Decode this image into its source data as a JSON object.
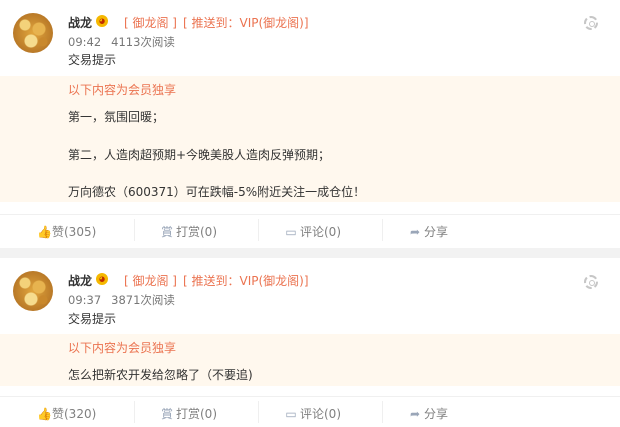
{
  "posts": [
    {
      "author": "战龙",
      "emoji": "😍",
      "tag1": "[ 御龙阁 ]",
      "tag2": "[ 推送到：VIP(御龙阁)]",
      "time": "09:42",
      "views": "4113次阅读",
      "title": "交易提示",
      "member_notice": "以下内容为会员独享",
      "lines": [
        "第一，氛围回暖；",
        "第二，人造肉超预期+今晚美股人造肉反弹预期；",
        "万向德农（600371）可在跌幅-5%附近关注一成仓位！"
      ],
      "actions": {
        "like": "赞(305)",
        "tip": "打赏(0)",
        "comment": "评论(0)",
        "share": "分享"
      }
    },
    {
      "author": "战龙",
      "emoji": "😍",
      "tag1": "[ 御龙阁 ]",
      "tag2": "[ 推送到：VIP(御龙阁)]",
      "time": "09:37",
      "views": "3871次阅读",
      "title": "交易提示",
      "member_notice": "以下内容为会员独享",
      "lines": [
        "怎么把新农开发给忽略了（不要追)"
      ],
      "actions": {
        "like": "赞(320)",
        "tip": "打赏(0)",
        "comment": "评论(0)",
        "share": "分享"
      }
    }
  ],
  "colors": {
    "accent": "#eb7350",
    "member_bg": "#fff8ee",
    "icon": "#9aa6b8"
  },
  "icons": {
    "like": "thumbs-up-icon",
    "tip": "reward-icon",
    "comment": "comment-icon",
    "share": "share-icon",
    "settings": "gear-icon"
  }
}
